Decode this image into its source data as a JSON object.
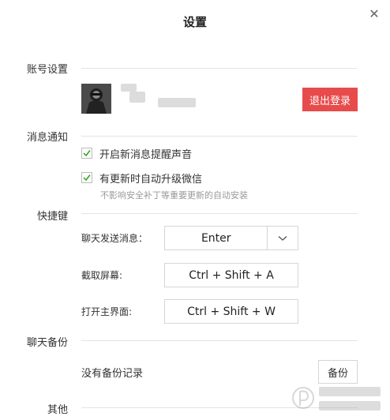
{
  "dialog": {
    "title": "设置",
    "close_icon": "close-icon"
  },
  "account": {
    "section_label": "账号设置",
    "logout_label": "退出登录",
    "logout_color": "#e84b4b"
  },
  "notifications": {
    "section_label": "消息通知",
    "items": [
      {
        "label": "开启新消息提醒声音",
        "checked": true
      },
      {
        "label": "有更新时自动升级微信",
        "checked": true
      }
    ],
    "hint": "不影响安全补丁等重要更新的自动安装"
  },
  "shortcuts": {
    "section_label": "快捷键",
    "send": {
      "label": "聊天发送消息：",
      "value": "Enter"
    },
    "screenshot": {
      "label": "截取屏幕:",
      "value": "Ctrl + Shift + A"
    },
    "main_window": {
      "label": "打开主界面:",
      "value": "Ctrl + Shift + W"
    }
  },
  "backup": {
    "section_label": "聊天备份",
    "status": "没有备份记录",
    "button_label": "备份"
  },
  "other": {
    "section_label": "其他"
  }
}
